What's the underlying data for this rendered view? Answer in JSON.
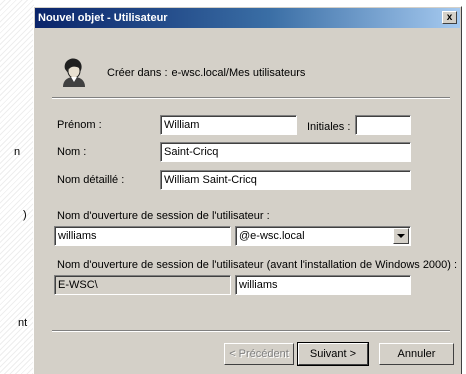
{
  "background": {
    "snippets": [
      "n",
      ")",
      "nt"
    ]
  },
  "window": {
    "title": "Nouvel objet - Utilisateur",
    "close_glyph": "x"
  },
  "header": {
    "create_in_label": "Créer dans :",
    "create_in_path": "e-wsc.local/Mes utilisateurs"
  },
  "form": {
    "first_name_label": "Prénom :",
    "first_name_value": "William",
    "initials_label": "Initiales :",
    "initials_value": "",
    "last_name_label": "Nom :",
    "last_name_value": "Saint-Cricq",
    "full_name_label": "Nom détaillé :",
    "full_name_value": "William Saint-Cricq",
    "logon_label": "Nom d'ouverture de session de l'utilisateur :",
    "logon_value": "williams",
    "domain_value": "@e-wsc.local",
    "pre2000_label": "Nom d'ouverture de session de l'utilisateur (avant l'installation de Windows 2000) :",
    "pre2000_domain": "E-WSC\\",
    "pre2000_value": "williams"
  },
  "buttons": {
    "previous": "< Précédent",
    "next": "Suivant >",
    "cancel": "Annuler"
  },
  "colors": {
    "dialog_face": "#d4d0c8",
    "titlebar_start": "#0a246a",
    "titlebar_end": "#a6caf0"
  }
}
